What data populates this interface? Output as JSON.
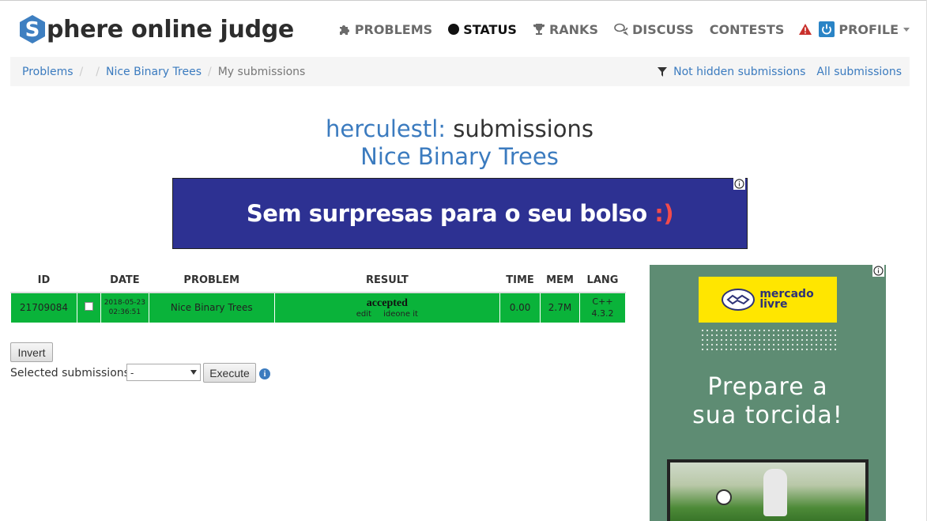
{
  "brand": {
    "logo_letter": "S",
    "logo_rest": "phere online judge"
  },
  "nav": {
    "problems": "PROBLEMS",
    "status": "STATUS",
    "ranks": "RANKS",
    "discuss": "DISCUSS",
    "contests": "CONTESTS",
    "profile": "PROFILE"
  },
  "breadcrumb": {
    "items": [
      "Problems",
      "",
      "Nice Binary Trees",
      "My submissions"
    ],
    "not_hidden": "Not hidden submissions",
    "all": "All submissions"
  },
  "title": {
    "user": "herculestl:",
    "rest": " submissions",
    "problem": "Nice Binary Trees"
  },
  "ad_top": {
    "text": "Sem surpresas para o seu bolso ",
    "smile": ":)"
  },
  "table": {
    "headers": [
      "ID",
      "",
      "DATE",
      "PROBLEM",
      "RESULT",
      "TIME",
      "MEM",
      "LANG"
    ],
    "rows": [
      {
        "id": "21709084",
        "date_day": "2018-05-23",
        "date_time": "02:36:51",
        "problem": "Nice Binary Trees",
        "result": "accepted",
        "link_edit": "edit",
        "link_ideone": "ideone it",
        "time": "0.00",
        "mem": "2.7M",
        "lang_name": "C++",
        "lang_ver": "4.3.2"
      }
    ]
  },
  "actions": {
    "invert": "Invert",
    "selected_label": "Selected submissions:",
    "select_value": "-",
    "execute": "Execute"
  },
  "ad_side": {
    "brand_line1": "mercado",
    "brand_line2": "livre",
    "headline1": "Prepare a",
    "headline2": "sua torcida!"
  },
  "colors": {
    "accent": "#3b7bbf",
    "accepted_bg": "#0ab33a",
    "ad_top_bg": "#2d3192",
    "ad_side_bg": "#5e8c73",
    "brand_yellow": "#ffe600"
  }
}
